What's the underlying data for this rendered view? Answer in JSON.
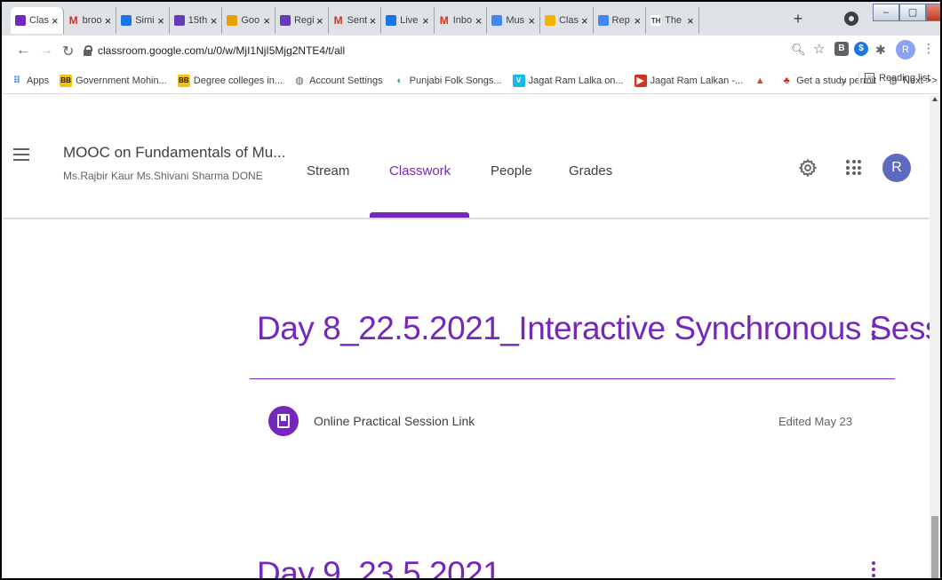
{
  "browser": {
    "tabs": [
      {
        "label": "Clas",
        "icon": "classroom-icon",
        "color": "#7627bb",
        "letter": "",
        "active": true
      },
      {
        "label": "broo",
        "icon": "gmail-icon",
        "color": "#d93025",
        "letter": "M"
      },
      {
        "label": "Simi",
        "icon": "drive-icon",
        "color": "#1a73e8",
        "letter": ""
      },
      {
        "label": "15th",
        "icon": "forms-icon",
        "color": "#673ab7",
        "letter": ""
      },
      {
        "label": "Goo",
        "icon": "chrome-icon",
        "color": "#e6a200",
        "letter": ""
      },
      {
        "label": "Regi",
        "icon": "forms-icon",
        "color": "#673ab7",
        "letter": ""
      },
      {
        "label": "Sent",
        "icon": "gmail-icon",
        "color": "#d93025",
        "letter": "M"
      },
      {
        "label": "Live",
        "icon": "drive-icon",
        "color": "#1a73e8",
        "letter": ""
      },
      {
        "label": "Inbo",
        "icon": "gmail-icon",
        "color": "#d93025",
        "letter": "M"
      },
      {
        "label": "Mus",
        "icon": "docs-icon",
        "color": "#4285f4",
        "letter": ""
      },
      {
        "label": "Clas",
        "icon": "classroom-icon",
        "color": "#f5b400",
        "letter": ""
      },
      {
        "label": "Rep",
        "icon": "docs-icon",
        "color": "#4285f4",
        "letter": ""
      },
      {
        "label": "The",
        "icon": "th-icon",
        "color": "#ffffff",
        "letter": "TH"
      }
    ],
    "new_tab": "+",
    "url": "classroom.google.com/u/0/w/MjI1NjI5Mjg2NTE4/t/all",
    "extensions": [
      {
        "icon": "b-extension-icon",
        "letter": "B",
        "color": "#5f6368"
      },
      {
        "icon": "s-extension-icon",
        "letter": "$",
        "color": "#1a73e8"
      }
    ],
    "profile_letter": "R",
    "bookmarks": [
      {
        "label": "Apps",
        "icon": "apps-grid-icon"
      },
      {
        "label": "Government Mohin...",
        "icon": "bb-icon",
        "letter": "BB"
      },
      {
        "label": "Degree colleges in...",
        "icon": "bb-icon",
        "letter": "BB"
      },
      {
        "label": "Account Settings",
        "icon": "globe-icon"
      },
      {
        "label": "Punjabi Folk Songs...",
        "icon": "chrome-web-icon"
      },
      {
        "label": "Jagat Ram Lalka on...",
        "icon": "vimeo-icon",
        "letter": "V"
      },
      {
        "label": "Jagat Ram Lalkan -...",
        "icon": "youtube-icon"
      },
      {
        "label": "",
        "icon": "triangle-icon"
      },
      {
        "label": "Get a study permit",
        "icon": "maple-leaf-icon"
      },
      {
        "label": "Next >>",
        "icon": "globe-icon"
      }
    ],
    "bookmarks_more": "»",
    "reading_list": "Reading list"
  },
  "classroom": {
    "class_title": "MOOC on Fundamentals of Mu...",
    "class_subtitle": "Ms.Rajbir Kaur Ms.Shivani Sharma DONE",
    "nav_tabs": {
      "stream": "Stream",
      "classwork": "Classwork",
      "people": "People",
      "grades": "Grades"
    },
    "active_tab": "Classwork",
    "accent_color": "#7627bb",
    "avatar_letter": "R",
    "topics": [
      {
        "title": "Day 8_22.5.2021_Interactive Synchronous Sess...",
        "items": [
          {
            "title": "Online Practical Session Link",
            "date": "Edited May 23",
            "icon": "material-icon"
          }
        ]
      },
      {
        "title": "Day 9_23.5.2021"
      }
    ]
  }
}
